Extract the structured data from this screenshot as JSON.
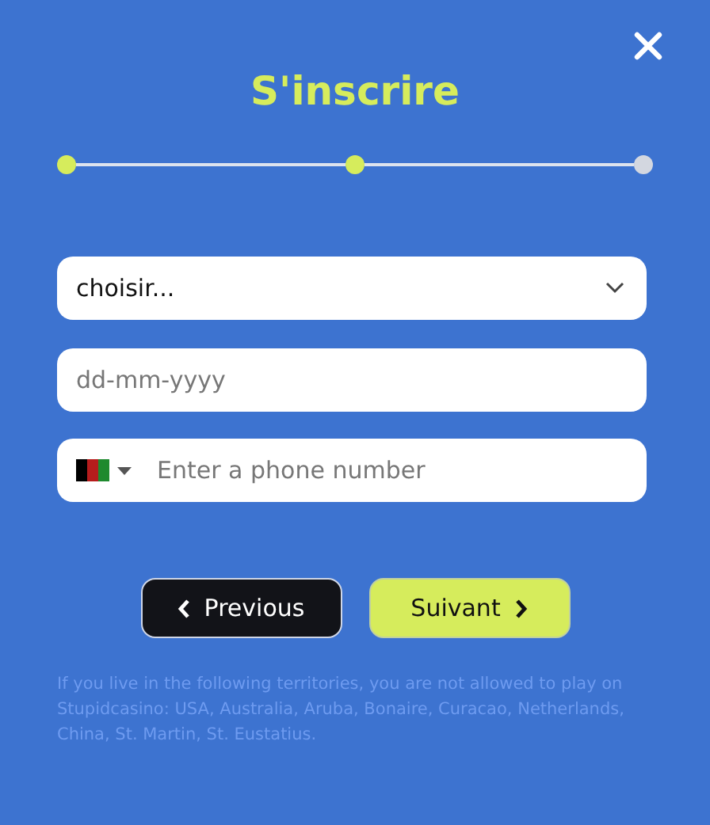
{
  "title": "S'inscrire",
  "steps": [
    {
      "done": true
    },
    {
      "done": true
    },
    {
      "done": false
    }
  ],
  "select": {
    "value": "choisir..."
  },
  "date": {
    "placeholder": "dd-mm-yyyy"
  },
  "phone": {
    "placeholder": "Enter a phone number"
  },
  "buttons": [
    {
      "kind": "back",
      "label": "Previous"
    },
    {
      "kind": "next",
      "label": "Suivant"
    }
  ],
  "disclaimer": "If you live in the following territories, you are not allowed to play on Stupidcasino: USA, Australia, Aruba, Bonaire, Curacao, Netherlands, China, St. Martin, St. Eustatius."
}
